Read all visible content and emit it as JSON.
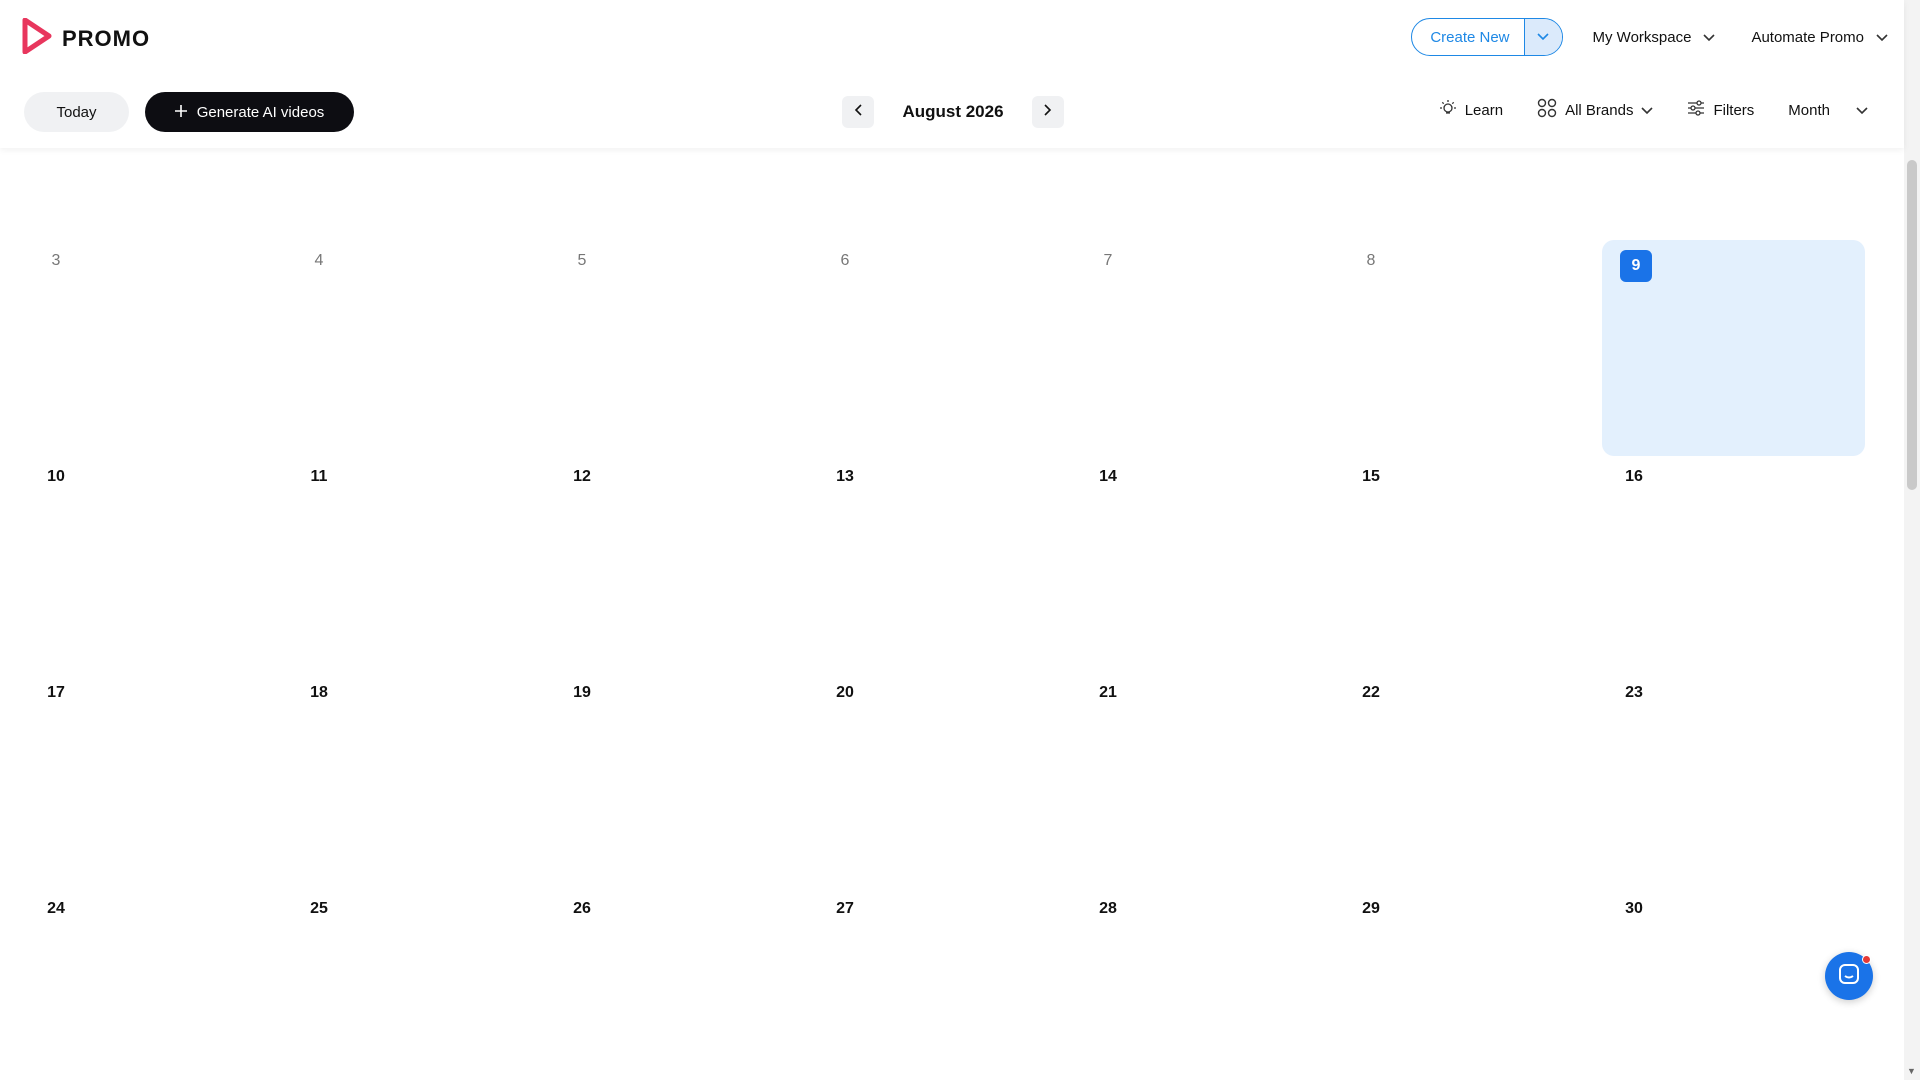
{
  "app": {
    "logo_text": "PROMO"
  },
  "header": {
    "create_new": "Create New",
    "workspace": "My Workspace",
    "account": "Automate Promo"
  },
  "toolbar": {
    "today": "Today",
    "generate": "Generate AI videos",
    "month_label": "August 2026",
    "learn": "Learn",
    "brands": "All Brands",
    "filters": "Filters",
    "view": "Month"
  },
  "calendar": {
    "weeks": [
      [
        "3",
        "4",
        "5",
        "6",
        "7",
        "8",
        "9"
      ],
      [
        "10",
        "11",
        "12",
        "13",
        "14",
        "15",
        "16"
      ],
      [
        "17",
        "18",
        "19",
        "20",
        "21",
        "22",
        "23"
      ],
      [
        "24",
        "25",
        "26",
        "27",
        "28",
        "29",
        "30"
      ]
    ],
    "past_days": [
      "3",
      "4",
      "5",
      "6",
      "7",
      "8"
    ],
    "today": "9"
  },
  "colors": {
    "accent": "#1a73e8",
    "today_bg": "#e3f0fd",
    "logo": "#e8365d"
  }
}
